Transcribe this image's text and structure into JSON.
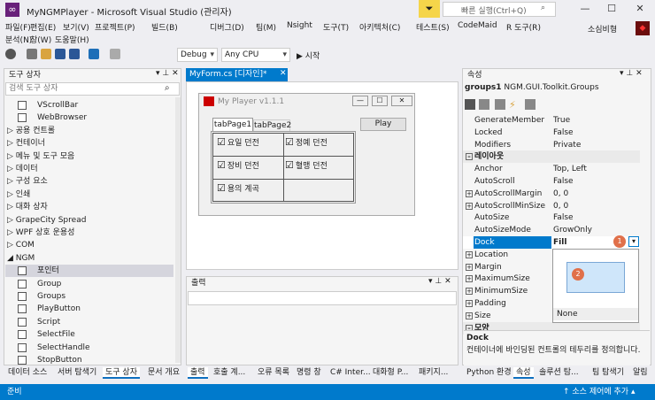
{
  "window": {
    "title": "MyNGMPlayer - Microsoft Visual Studio (관리자)",
    "quick_launch": "빠른 실행(Ctrl+Q)",
    "user": "소심비형"
  },
  "menu": {
    "row1": [
      "파일(F)",
      "편집(E)",
      "보기(V)",
      "프로젝트(P)",
      "빌드(B)",
      "디버그(D)",
      "팀(M)",
      "Nsight",
      "도구(T)",
      "아키텍처(C)",
      "테스트(S)",
      "CodeMaid",
      "R 도구(R)"
    ],
    "row2": [
      "분석(N)",
      "창(W)",
      "도움말(H)"
    ]
  },
  "toolbar": {
    "config": "Debug",
    "platform": "Any CPU",
    "start": "▶ 시작"
  },
  "toolbox": {
    "title": "도구 상자",
    "search_placeholder": "검색 도구 상자",
    "items": [
      {
        "label": "VScrollBar",
        "type": "item"
      },
      {
        "label": "WebBrowser",
        "type": "item"
      },
      {
        "label": "▷ 공용 컨트롤",
        "type": "cat"
      },
      {
        "label": "▷ 컨테이너",
        "type": "cat"
      },
      {
        "label": "▷ 메뉴 및 도구 모음",
        "type": "cat"
      },
      {
        "label": "▷ 데이터",
        "type": "cat"
      },
      {
        "label": "▷ 구성 요소",
        "type": "cat"
      },
      {
        "label": "▷ 인쇄",
        "type": "cat"
      },
      {
        "label": "▷ 대화 상자",
        "type": "cat"
      },
      {
        "label": "▷ GrapeCity Spread",
        "type": "cat"
      },
      {
        "label": "▷ WPF 상호 운용성",
        "type": "cat"
      },
      {
        "label": "▷ COM",
        "type": "cat"
      },
      {
        "label": "◢ NGM",
        "type": "cat"
      },
      {
        "label": "포인터",
        "type": "sel"
      },
      {
        "label": "Group",
        "type": "item"
      },
      {
        "label": "Groups",
        "type": "item"
      },
      {
        "label": "PlayButton",
        "type": "item"
      },
      {
        "label": "Script",
        "type": "item"
      },
      {
        "label": "SelectFile",
        "type": "item"
      },
      {
        "label": "SelectHandle",
        "type": "item"
      },
      {
        "label": "StopButton",
        "type": "item"
      }
    ],
    "tabs": [
      "데이터 소스",
      "서버 탐색기",
      "도구 상자",
      "문서 개요"
    ]
  },
  "document": {
    "tab": "MyForm.cs [디자인]*",
    "form_title": "My Player v1.1.1",
    "tabs": [
      "tabPage1",
      "tabPage2"
    ],
    "play": "Play",
    "checks": [
      "요일 던전",
      "정예 던전",
      "장비 던전",
      "혈맹 던전",
      "용의 계곡"
    ]
  },
  "output": {
    "title": "출력",
    "tabs": [
      "출력",
      "호출 계...",
      "오류 목록",
      "명령 창",
      "C# Inter...",
      "대화형 P...",
      "패키지..."
    ]
  },
  "properties": {
    "title": "속성",
    "object": "groups1",
    "object_type": "NGM.GUI.Toolkit.Groups",
    "rows": [
      {
        "name": "GenerateMember",
        "value": "True",
        "ex": ""
      },
      {
        "name": "Locked",
        "value": "False",
        "ex": ""
      },
      {
        "name": "Modifiers",
        "value": "Private",
        "ex": ""
      },
      {
        "name": "레이아웃",
        "value": "",
        "ex": "cat"
      },
      {
        "name": "Anchor",
        "value": "Top, Left",
        "ex": ""
      },
      {
        "name": "AutoScroll",
        "value": "False",
        "ex": ""
      },
      {
        "name": "AutoScrollMargin",
        "value": "0, 0",
        "ex": "+"
      },
      {
        "name": "AutoScrollMinSize",
        "value": "0, 0",
        "ex": "+"
      },
      {
        "name": "AutoSize",
        "value": "False",
        "ex": ""
      },
      {
        "name": "AutoSizeMode",
        "value": "GrowOnly",
        "ex": ""
      },
      {
        "name": "Dock",
        "value": "Fill",
        "ex": "sel"
      },
      {
        "name": "Location",
        "value": "",
        "ex": "+"
      },
      {
        "name": "Margin",
        "value": "",
        "ex": "+"
      },
      {
        "name": "MaximumSize",
        "value": "",
        "ex": "+"
      },
      {
        "name": "MinimumSize",
        "value": "",
        "ex": "+"
      },
      {
        "name": "Padding",
        "value": "",
        "ex": "+"
      },
      {
        "name": "Size",
        "value": "",
        "ex": "+"
      },
      {
        "name": "모양",
        "value": "",
        "ex": "cat"
      }
    ],
    "dock_none": "None",
    "badge1": "1",
    "badge2": "2",
    "desc_title": "Dock",
    "desc_text": "컨테이너에 바인딩된 컨트롤의 테두리를 정의합니다.",
    "tabs": [
      "Python 환경",
      "속성",
      "솔루션 탐...",
      "팀 탐색기",
      "알림"
    ]
  },
  "status": {
    "left": "준비",
    "right": "↑ 소스 제어에 추가 ▴"
  },
  "colors": {
    "accent": "#007acc",
    "badge": "#e0704a"
  }
}
